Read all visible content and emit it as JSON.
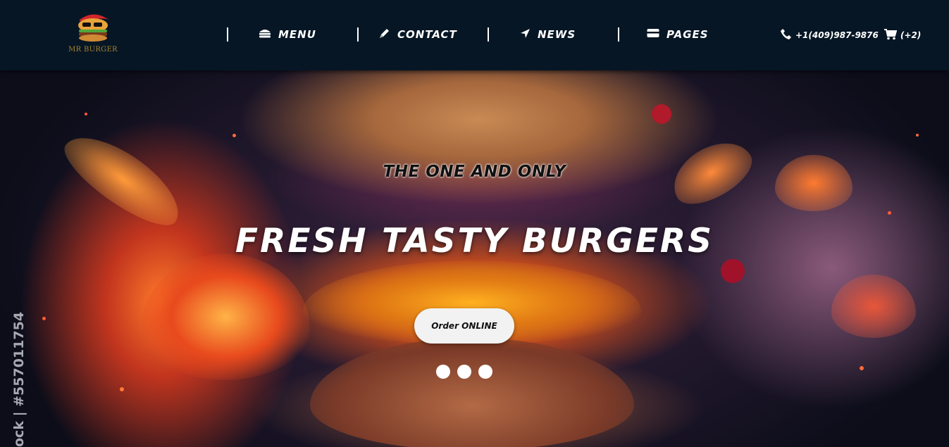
{
  "brand": {
    "logo_text": "MR BURGER"
  },
  "nav": {
    "items": [
      {
        "label": "MENU",
        "icon": "hamburger-icon"
      },
      {
        "label": "CONTACT",
        "icon": "pen-icon"
      },
      {
        "label": "NEWS",
        "icon": "location-arrow-icon"
      },
      {
        "label": "PAGES",
        "icon": "card-icon"
      }
    ]
  },
  "contact": {
    "phone": "+1(409)987-9876",
    "cart": "(+2)"
  },
  "hero": {
    "tagline": "THE ONE AND ONLY",
    "title": "FRESH TASTY BURGERS",
    "cta": "Order ONLINE",
    "slides": 3,
    "watermark": "ock | #557011754"
  },
  "colors": {
    "navbar": "#061625",
    "accent": "#e2901a",
    "button": "#f2f2f2"
  }
}
